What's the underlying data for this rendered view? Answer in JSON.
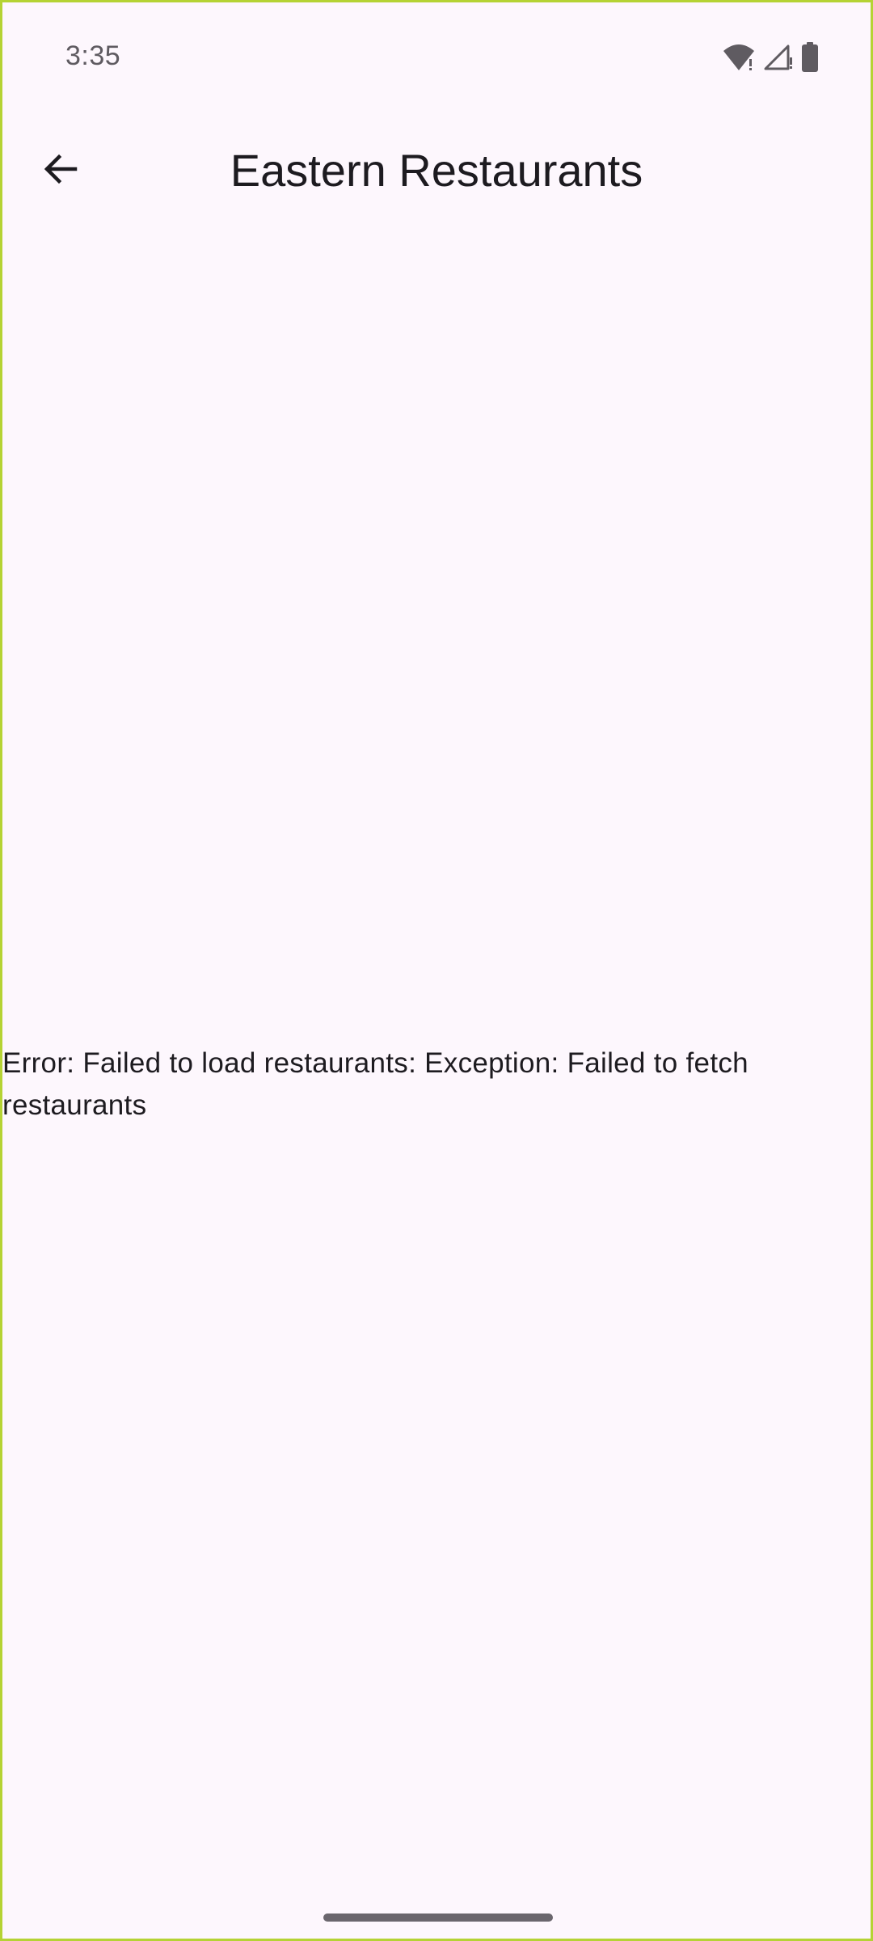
{
  "status_bar": {
    "time": "3:35",
    "icons": [
      "wifi-icon",
      "cell-signal-icon",
      "battery-icon"
    ]
  },
  "app_bar": {
    "title": "Eastern Restaurants",
    "back_icon": "arrow-left-icon"
  },
  "content": {
    "error_message": "Error: Failed to load restaurants: Exception: Failed to fetch restaurants"
  },
  "colors": {
    "background": "#fdf7fd",
    "text": "#1d1b20",
    "status_text": "#5f5b61",
    "frame_border": "#b5d334"
  }
}
